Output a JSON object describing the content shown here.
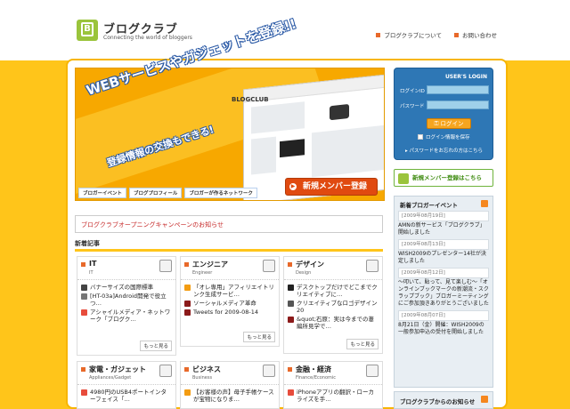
{
  "header": {
    "logo_title": "ブログクラブ",
    "logo_tagline": "Connecting the world of bloggers",
    "links": [
      {
        "label": "ブログクラブについて"
      },
      {
        "label": "お問い合わせ"
      }
    ]
  },
  "hero": {
    "headline": "WEBサービスやガジェットを登録!!",
    "subline": "登録情報の交換もできる!",
    "blog_label": "BLOGCLUB",
    "tabs": [
      "ブロガーイベント",
      "ブログプロフィール",
      "ブロガーが作るネットワーク"
    ],
    "cta_label": "新規メンバー登録"
  },
  "notice": {
    "text": "ブログクラブオープニングキャンペーンのお知らせ"
  },
  "articles": {
    "title": "新着記事",
    "more_label": "もっと見る",
    "categories": [
      {
        "name": "IT",
        "sub": "IT",
        "items": [
          "バナーサイズの国際標準",
          "[HT-03a]Android開発で役立つ…",
          "アシャイルメディア・ネットワーク「ブログク…"
        ]
      },
      {
        "name": "エンジニア",
        "sub": "Engineer",
        "items": [
          "「オレ専用」アフィリエイトリンク生成サービ…",
          "ソーシャルメディア革命",
          "Tweets for 2009-08-14"
        ]
      },
      {
        "name": "デザイン",
        "sub": "Design",
        "items": [
          "デスクトップだけでどこまでクリエイティブに…",
          "クリエイティブなロゴデザイン20",
          "&quot;石原：実は今までの葦編所見学で…"
        ]
      },
      {
        "name": "家電・ガジェット",
        "sub": "Appliances/Gadget",
        "items": [
          "4980円のUSB4ポートインターフェイス「…"
        ]
      },
      {
        "name": "ビジネス",
        "sub": "Business",
        "items": [
          "【お客様の声】母子手帳ケースが宝物になりま…"
        ]
      },
      {
        "name": "金融・経済",
        "sub": "Finance/Economic",
        "items": [
          "iPhoneアプリの翻訳・ローカライズを手…"
        ]
      }
    ]
  },
  "login": {
    "title": "USER'S LOGIN",
    "id_label": "ログインID",
    "password_label": "パスワード",
    "button_label": "ログイン",
    "remember_label": "ログイン情報を保存",
    "forgot_label": "パスワードをお忘れの方はこちら"
  },
  "new_member": {
    "label": "新規メンバー登録はこちら"
  },
  "events": {
    "title": "新着ブロガーイベント",
    "items": [
      {
        "date": "[2009年08月19日]",
        "text": "AMNの新サービス「ブログクラブ」開始しました"
      },
      {
        "date": "[2009年08月13日]",
        "text": "WISH2009のプレゼンター14社が決定しました"
      },
      {
        "date": "[2009年08月12日]",
        "text": "〜叩いて、貼って、見て楽しむ〜「オンラインブックマークの新潮流・スクラップブック」ブロガーミーティングにご参加頂きありがとうございました"
      },
      {
        "date": "[2009年08月07日]",
        "text": "8月21日（金）開催：WISH2009の一般参加申込の受付を開始しました"
      }
    ]
  },
  "from_club": {
    "title": "ブログクラブからのお知らせ"
  },
  "colors": {
    "accent": "#ffc51a",
    "brand_green": "#9ac43c",
    "login_blue": "#2e77b5",
    "cta_orange": "#e04a10"
  }
}
